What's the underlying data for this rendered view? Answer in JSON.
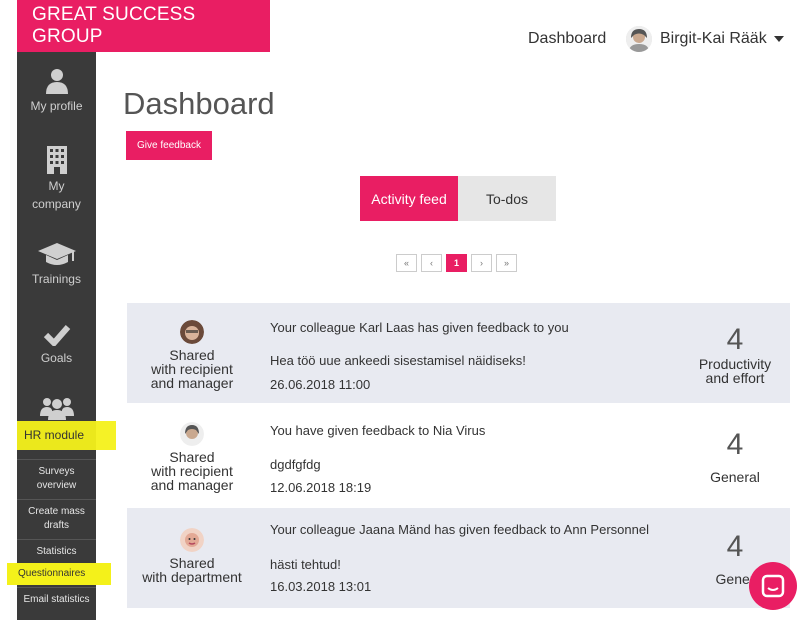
{
  "brand": "GREAT SUCCESS GROUP",
  "sidebar": {
    "items": [
      {
        "label": "My profile",
        "icon": "user-icon"
      },
      {
        "label": "My company",
        "icon": "building-icon"
      },
      {
        "label": "Trainings",
        "icon": "graduation-cap-icon"
      },
      {
        "label": "Goals",
        "icon": "check-icon"
      },
      {
        "label": "HR module",
        "icon": "users-icon"
      }
    ],
    "sub_items": [
      "Surveys overview",
      "Create mass drafts",
      "Statistics",
      "Questionnaires",
      "Email statistics"
    ]
  },
  "topnav": {
    "dashboard": "Dashboard",
    "user": "Birgit-Kai Rääk"
  },
  "page": {
    "title": "Dashboard",
    "give_feedback": "Give feedback"
  },
  "tabs": [
    {
      "label": "Activity feed",
      "active": true
    },
    {
      "label": "To-dos",
      "active": false
    }
  ],
  "pager": [
    "«",
    "‹",
    "1",
    "›",
    "»"
  ],
  "feed": [
    {
      "share_1": "Shared",
      "share_2": "with recipient",
      "share_3": "and manager",
      "title": "Your colleague Karl Laas has given feedback to you",
      "text": "Hea töö uue ankeedi sisestamisel näidiseks!",
      "date": "26.06.2018 11:00",
      "score": "4",
      "cat_1": "Productivity",
      "cat_2": "and effort"
    },
    {
      "share_1": "Shared",
      "share_2": "with recipient",
      "share_3": "and manager",
      "title": "You have given feedback to Nia Virus",
      "text": "dgdfgfdg",
      "date": "12.06.2018 18:19",
      "score": "4",
      "cat_1": "General",
      "cat_2": ""
    },
    {
      "share_1": "Shared",
      "share_2": "with department",
      "share_3": "",
      "title": "Your colleague Jaana Mänd has given feedback to Ann Personnel",
      "text": "hästi tehtud!",
      "date": "16.03.2018 13:01",
      "score": "4",
      "cat_1": "Gener",
      "cat_2": ""
    }
  ],
  "colors": {
    "accent": "#e91e63",
    "sidebar": "#3a3a3a",
    "highlight": "#f4f11a",
    "row_shade": "#e8eaf1"
  }
}
